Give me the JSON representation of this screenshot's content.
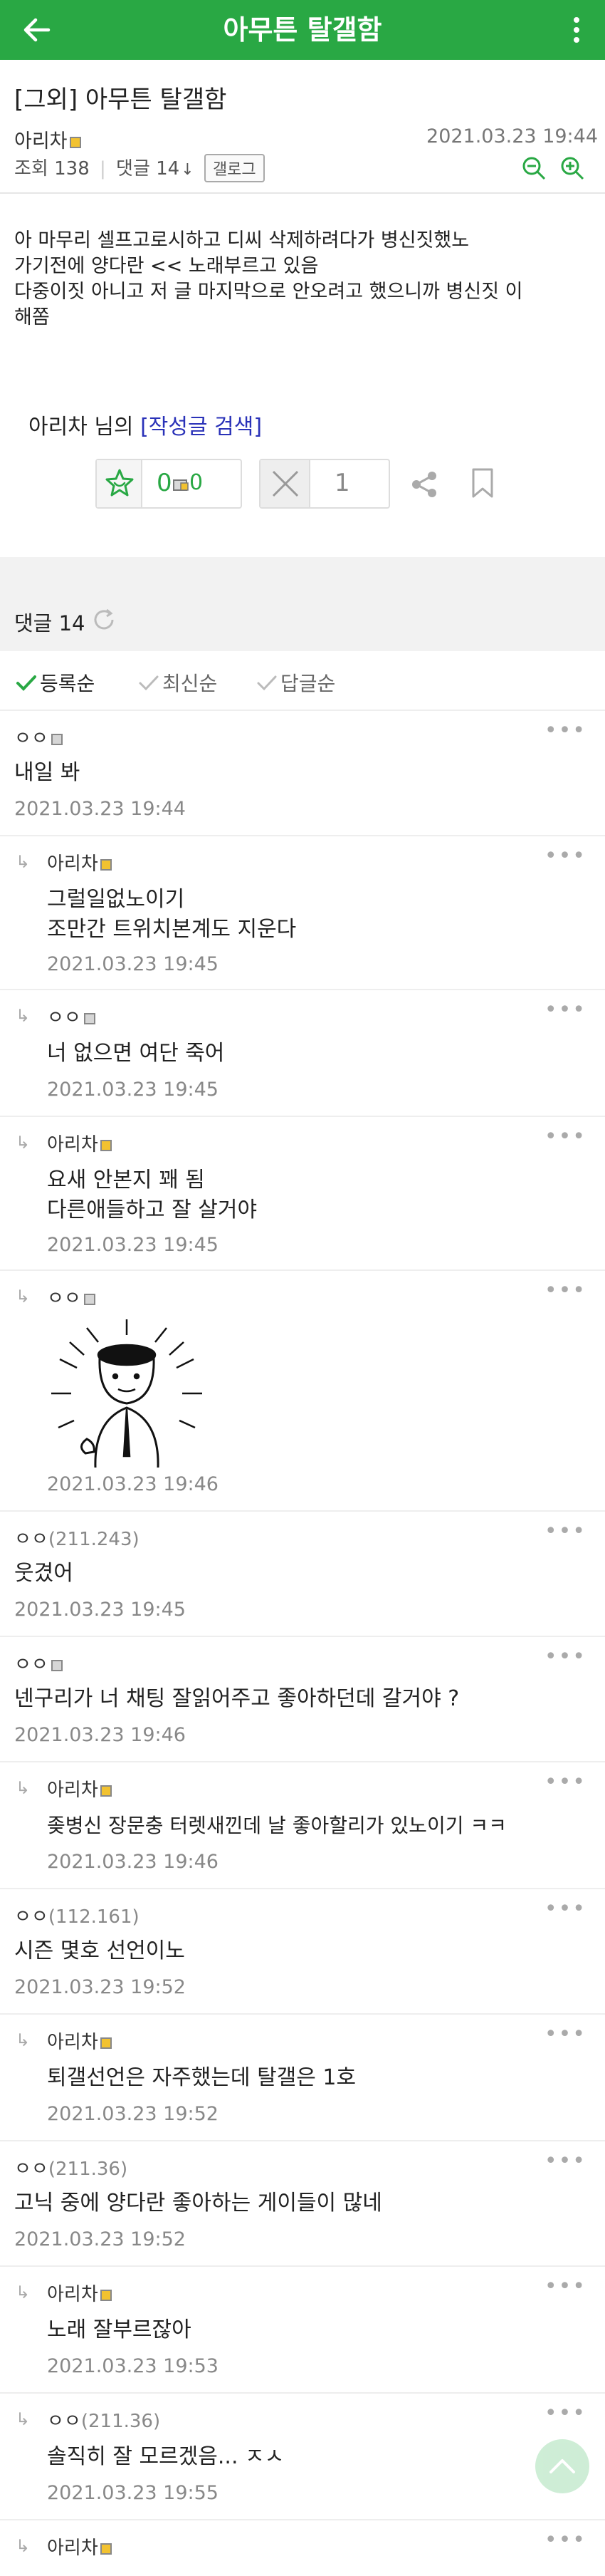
{
  "topbar": {
    "title": "아무튼 탈갤함"
  },
  "post": {
    "title": "[그외] 아무튼 탈갤함",
    "author": "아리차",
    "date": "2021.03.23 19:44",
    "views": "조회 138",
    "comment_count": "댓글 14",
    "gallog_label": "갤로그",
    "body_lines": [
      "아 마무리 셀프고로시하고 디씨 삭제하려다가 병신짓했노",
      "가기전에 양다란 << 노래부르고 있음",
      "다중이짓 아니고 저 글 마지막으로 안오려고 했으니까 병신짓 이",
      "해쫌"
    ],
    "author_search_prefix": "아리차 님의 ",
    "author_search_link": "[작성글 검색]",
    "recommend_count": "0",
    "fix_recommend_count": "0",
    "not_recommend_count": "1"
  },
  "comments_header": {
    "label": "댓글 14"
  },
  "sort_options": [
    "등록순",
    "최신순",
    "답글순"
  ],
  "comments": [
    {
      "nick": "ㅇㅇ",
      "ip": "",
      "lines": [
        "내일 봐"
      ],
      "date": "2021.03.23 19:44"
    },
    {
      "nick": "아리차",
      "ip": "",
      "lines": [
        "그럴일없노이기",
        "조만간 트위치본계도 지운다"
      ],
      "date": "2021.03.23 19:45"
    },
    {
      "nick": "ㅇㅇ",
      "ip": "",
      "lines": [
        "너 없으면 여단 죽어"
      ],
      "date": "2021.03.23 19:45"
    },
    {
      "nick": "아리차",
      "ip": "",
      "lines": [
        "요새 안본지 꽤 됨",
        "다른애들하고 잘 살거야"
      ],
      "date": "2021.03.23 19:45"
    },
    {
      "nick": "ㅇㅇ",
      "ip": "",
      "lines": [],
      "date": "2021.03.23 19:46"
    },
    {
      "nick": "ㅇㅇ",
      "ip": "(211.243)",
      "lines": [
        "웃겼어"
      ],
      "date": "2021.03.23 19:45"
    },
    {
      "nick": "ㅇㅇ",
      "ip": "",
      "lines": [
        "넨구리가 너 채팅 잘읽어주고 좋아하던데 갈거야 ?"
      ],
      "date": "2021.03.23 19:46"
    },
    {
      "nick": "아리차",
      "ip": "",
      "lines": [
        "좆병신 장문충 터렛새낀데 날 좋아할리가 있노이기 ㅋㅋ"
      ],
      "date": "2021.03.23 19:46"
    },
    {
      "nick": "ㅇㅇ",
      "ip": "(112.161)",
      "lines": [
        "시즌 몇호 선언이노"
      ],
      "date": "2021.03.23 19:52"
    },
    {
      "nick": "아리차",
      "ip": "",
      "lines": [
        "퇴갤선언은 자주했는데 탈갤은 1호"
      ],
      "date": "2021.03.23 19:52"
    },
    {
      "nick": "ㅇㅇ",
      "ip": "(211.36)",
      "lines": [
        "고닉 중에 양다란 좋아하는 게이들이 많네"
      ],
      "date": "2021.03.23 19:52"
    },
    {
      "nick": "아리차",
      "ip": "",
      "lines": [
        "노래 잘부르잖아"
      ],
      "date": "2021.03.23 19:53"
    },
    {
      "nick": "ㅇㅇ",
      "ip": "(211.36)",
      "lines": [
        "솔직히 잘 모르겠음... ㅈㅅ"
      ],
      "date": "2021.03.23 19:55"
    },
    {
      "nick": "아리차",
      "ip": "",
      "lines": [],
      "date": ""
    }
  ],
  "colors": {
    "brand": "#29a844",
    "link": "#2a32b8",
    "meta": "#888888"
  },
  "icons": [
    "back-arrow-icon",
    "more-vertical-icon",
    "zoom-out-icon",
    "zoom-in-icon",
    "refresh-icon",
    "recommend-star-icon",
    "fix-recommend-icon",
    "not-recommend-x-icon",
    "share-icon",
    "bookmark-icon",
    "check-icon",
    "reply-arrow-icon",
    "comment-more-icon",
    "scroll-top-icon"
  ]
}
